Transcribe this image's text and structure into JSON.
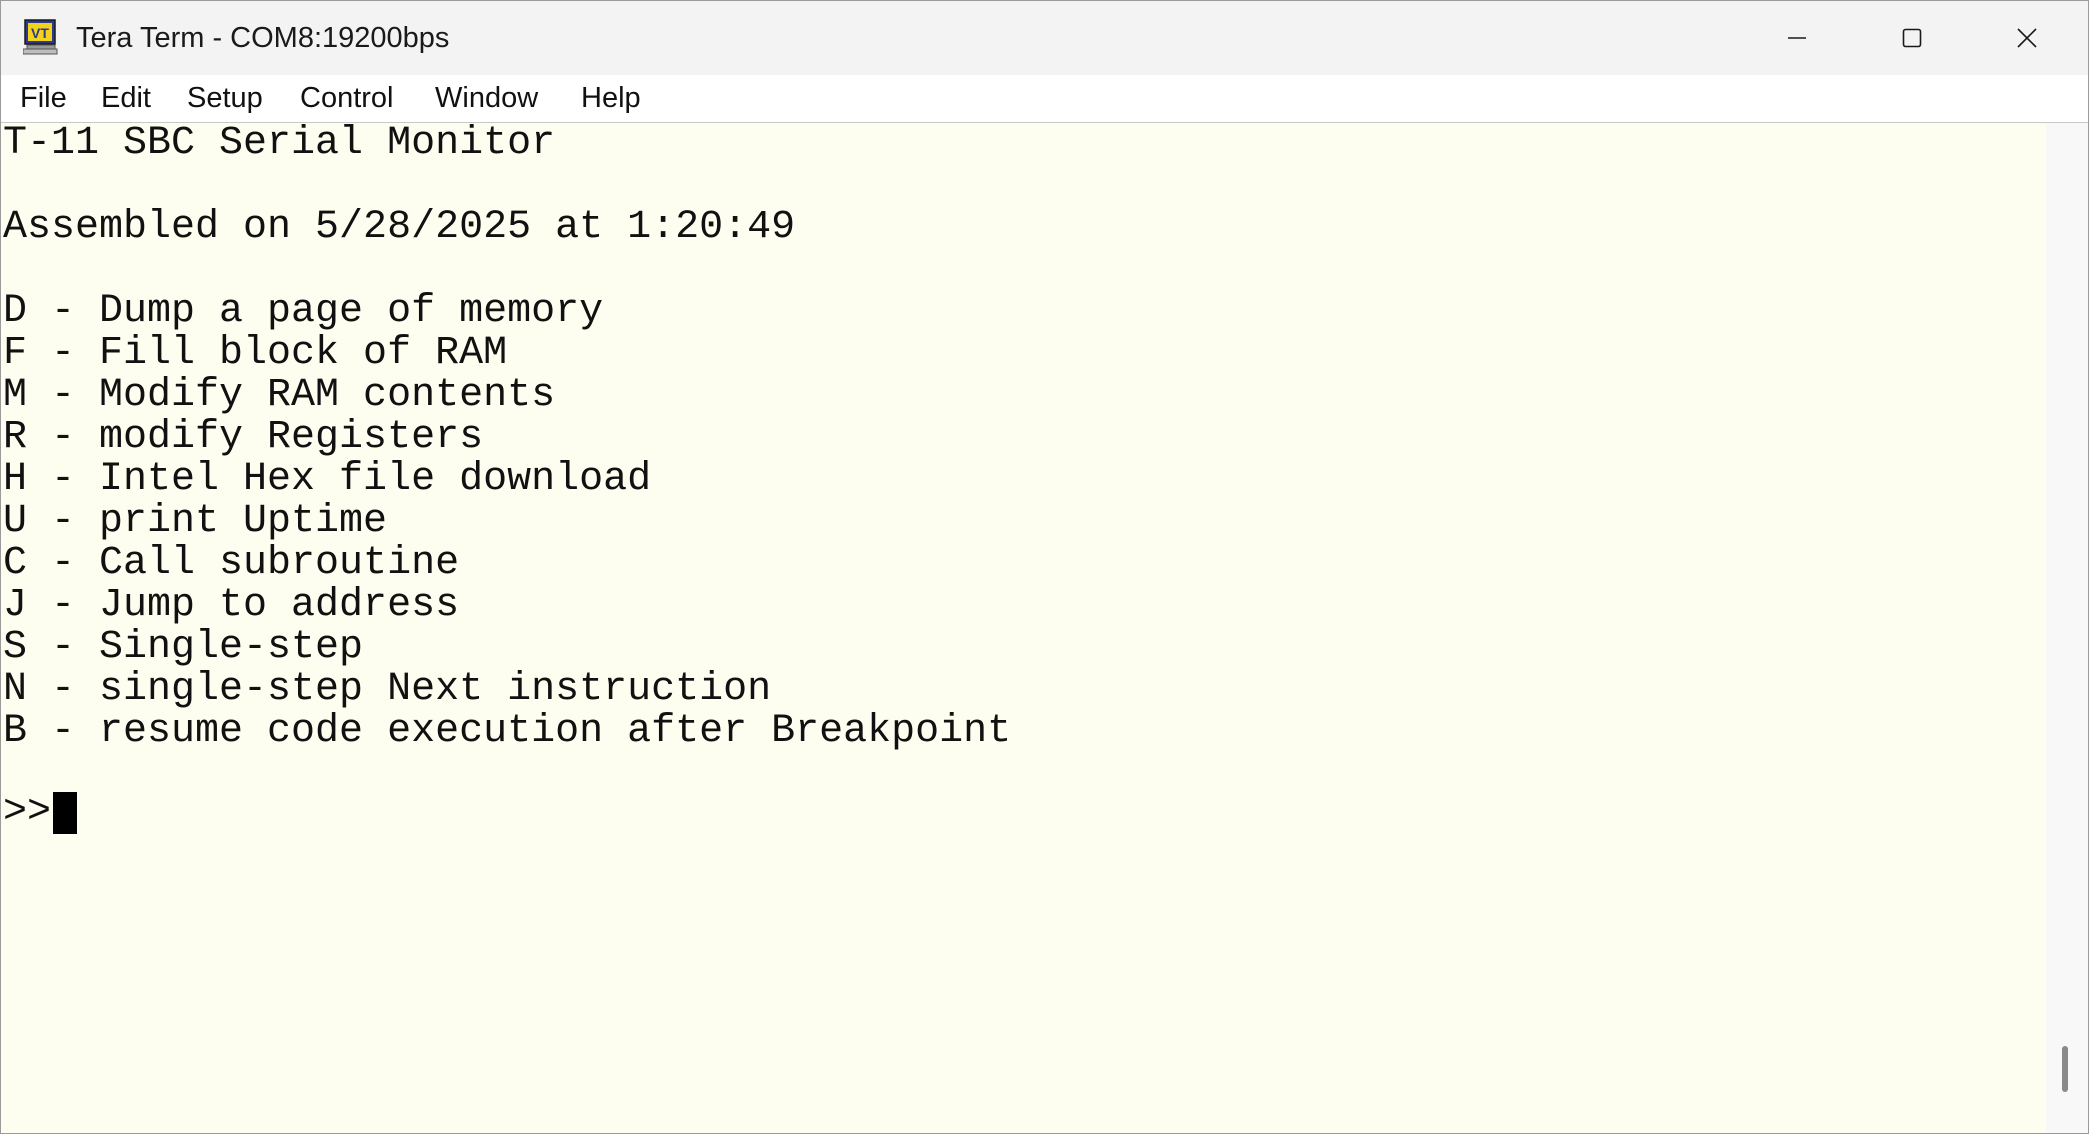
{
  "window": {
    "title": "Tera Term - COM8:19200bps",
    "icon": "vt-terminal-icon",
    "icon_text": "VT",
    "controls": [
      "minimize-icon",
      "maximize-icon",
      "close-icon"
    ]
  },
  "menu": {
    "file": "File",
    "edit": "Edit",
    "setup": "Setup",
    "control": "Control",
    "window": "Window",
    "help": "Help"
  },
  "terminal": {
    "background": "#fefef0",
    "lines": [
      "T-11 SBC Serial Monitor",
      "",
      "Assembled on 5/28/2025 at 1:20:49",
      "",
      "D - Dump a page of memory",
      "F - Fill block of RAM",
      "M - Modify RAM contents",
      "R - modify Registers",
      "H - Intel Hex file download",
      "U - print Uptime",
      "C - Call subroutine",
      "J - Jump to address",
      "S - Single-step",
      "N - single-step Next instruction",
      "B - resume code execution after Breakpoint"
    ],
    "prompt": ">>"
  }
}
